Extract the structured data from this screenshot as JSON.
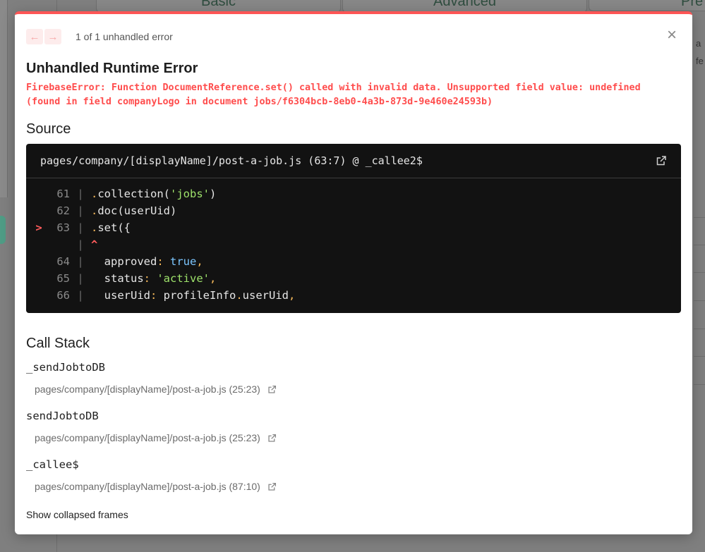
{
  "background": {
    "tabs": [
      "Basic",
      "Advanced",
      "Pre"
    ],
    "side_texts": [
      "a",
      "fe"
    ]
  },
  "modal": {
    "prev_icon": "arrow-left-icon",
    "next_icon": "arrow-right-icon",
    "error_count": "1 of 1 unhandled error",
    "close_icon": "close-icon",
    "title": "Unhandled Runtime Error",
    "message": "FirebaseError: Function DocumentReference.set() called with invalid data. Unsupported field value: undefined (found in field companyLogo in document jobs/f6304bcb-8eb0-4a3b-873d-9e460e24593b)",
    "source_heading": "Source",
    "source": {
      "file": "pages/company/[displayName]/post-a-job.js (63:7) @ _callee2$",
      "lines": [
        {
          "marker": "",
          "num": "61"
        },
        {
          "marker": "",
          "num": "62"
        },
        {
          "marker": ">",
          "num": "63"
        },
        {
          "marker": "",
          "num": ""
        },
        {
          "marker": "",
          "num": "64"
        },
        {
          "marker": "",
          "num": "65"
        },
        {
          "marker": "",
          "num": "66"
        }
      ],
      "code": {
        "l61_method": "collection(",
        "l61_str": "'jobs'",
        "l61_end": ")",
        "l62_method": "doc(userUid)",
        "l63_method": "set({",
        "caret": "^",
        "l64_key": "approved",
        "l64_val": "true",
        "l65_key": "status",
        "l65_val": "'active'",
        "l66_key": "userUid",
        "l66_obj": "profileInfo",
        "l66_prop": "userUid"
      }
    },
    "call_stack_heading": "Call Stack",
    "call_stack": [
      {
        "name": "_sendJobtoDB",
        "location": "pages/company/[displayName]/post-a-job.js (25:23)"
      },
      {
        "name": "sendJobtoDB",
        "location": "pages/company/[displayName]/post-a-job.js (25:23)"
      },
      {
        "name": "_callee$",
        "location": "pages/company/[displayName]/post-a-job.js (87:10)"
      }
    ],
    "show_collapsed": "Show collapsed frames"
  },
  "colors": {
    "accent_red": "#ff5555",
    "code_background": "#121212"
  }
}
